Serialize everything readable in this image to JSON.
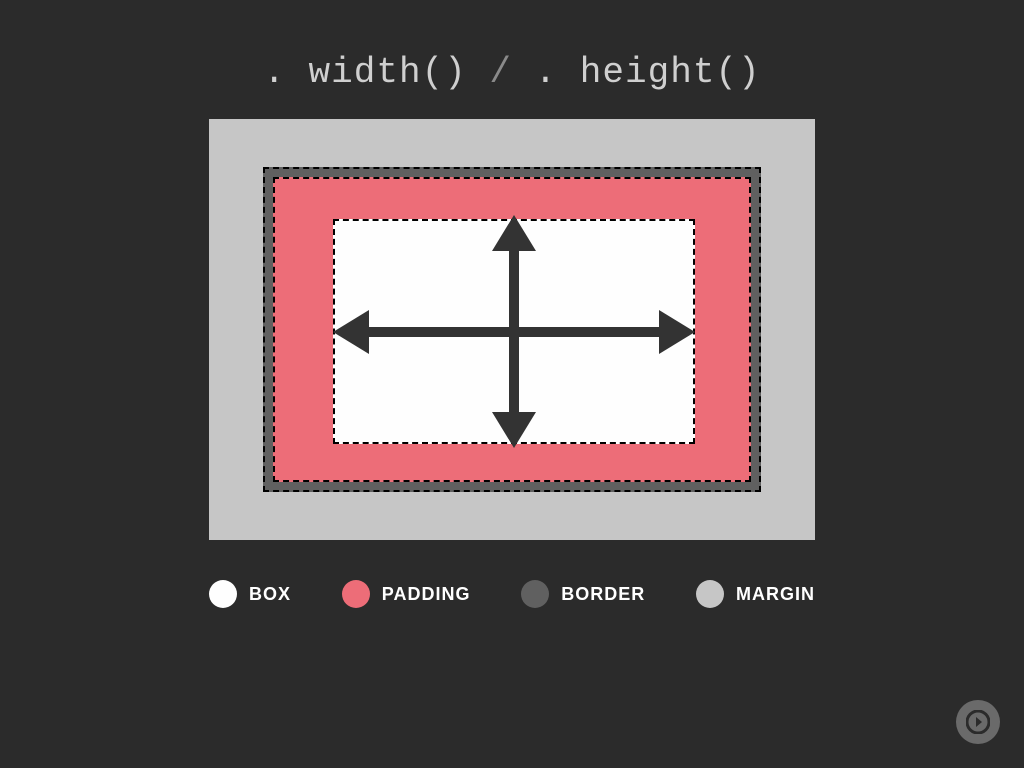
{
  "title": {
    "width_fn": ". width()",
    "separator": " / ",
    "height_fn": ". height()"
  },
  "layers": {
    "margin_color": "#c6c6c6",
    "border_color": "#606060",
    "padding_color": "#ed6d78",
    "box_color": "#fefefe"
  },
  "legend": [
    {
      "label": "BOX",
      "color": "#fefefe"
    },
    {
      "label": "PADDING",
      "color": "#ed6d78"
    },
    {
      "label": "BORDER",
      "color": "#606060"
    },
    {
      "label": "MARGIN",
      "color": "#c6c6c6"
    }
  ],
  "nav": {
    "next_icon": "arrow-right-circle-icon"
  }
}
